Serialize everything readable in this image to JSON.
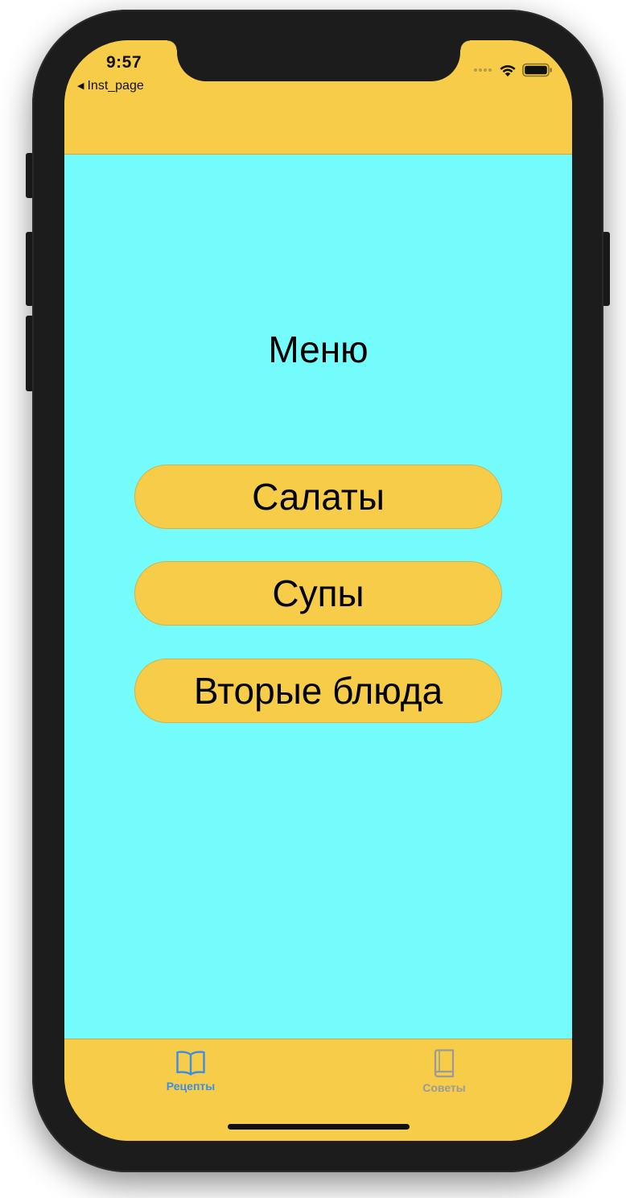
{
  "status_bar": {
    "time": "9:57",
    "back_label": "Inst_page",
    "back_icon": "back-triangle-icon",
    "wifi_icon": "wifi-icon",
    "battery_icon": "battery-icon"
  },
  "main": {
    "title": "Меню",
    "buttons": [
      {
        "label": "Салаты"
      },
      {
        "label": "Супы"
      },
      {
        "label": "Вторые блюда"
      }
    ]
  },
  "tabbar": {
    "tabs": [
      {
        "label": "Рецепты",
        "icon": "open-book-icon",
        "selected": true,
        "color": "#3a8ee6"
      },
      {
        "label": "Советы",
        "icon": "closed-book-icon",
        "selected": false,
        "color": "#9a9a9a"
      }
    ]
  },
  "colors": {
    "bars": "#f6cc49",
    "content_background": "#74fbfb",
    "accent": "#3a8ee6"
  }
}
